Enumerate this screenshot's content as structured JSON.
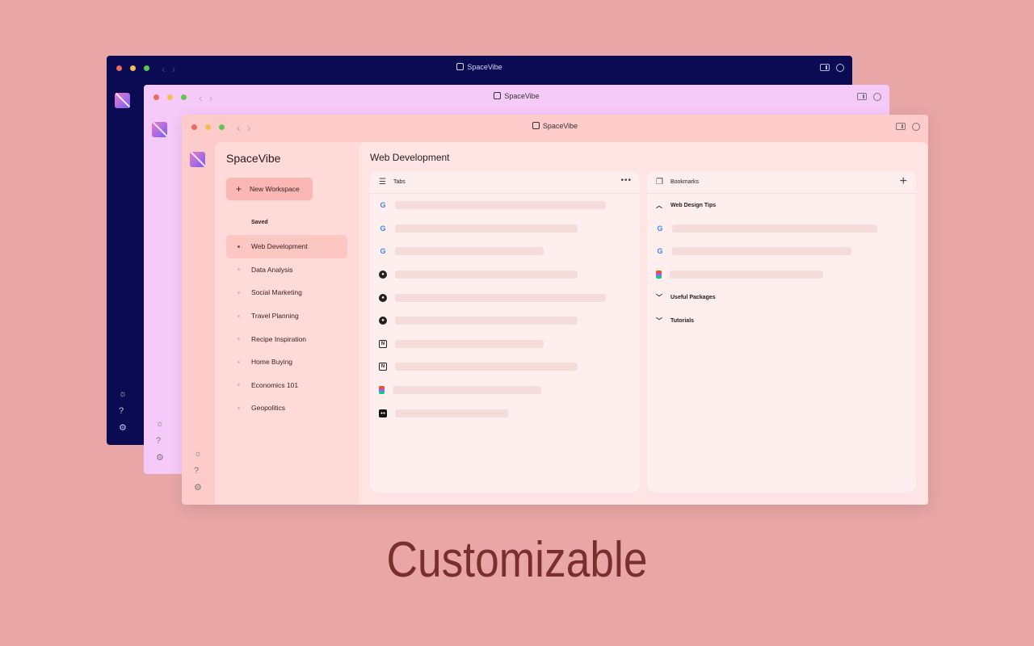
{
  "app": {
    "name": "SpaceVibe",
    "window_title": "SpaceVibe"
  },
  "window_colors": [
    "#0a0b52",
    "#f6caf8",
    "#fecbcb"
  ],
  "sidebar": {
    "new_workspace_label": "New Workspace",
    "saved_heading": "Saved",
    "workspaces": [
      {
        "label": "Web Development",
        "active": true
      },
      {
        "label": "Data Analysis"
      },
      {
        "label": "Social Marketing"
      },
      {
        "label": "Travel Planning"
      },
      {
        "label": "Recipe Inspiration"
      },
      {
        "label": "Home Buying"
      },
      {
        "label": "Economics 101"
      },
      {
        "label": "Geopolitics"
      }
    ]
  },
  "rail_icons": [
    "theme-sun-icon",
    "help-icon",
    "settings-gear-icon"
  ],
  "main": {
    "title": "Web Development",
    "tabs_panel": {
      "heading": "Tabs",
      "items": [
        {
          "icon": "google-icon",
          "fill": 0.82
        },
        {
          "icon": "google-icon",
          "fill": 0.71
        },
        {
          "icon": "google-icon",
          "fill": 0.58
        },
        {
          "icon": "github-icon",
          "fill": 0.71
        },
        {
          "icon": "github-icon",
          "fill": 0.82
        },
        {
          "icon": "github-icon",
          "fill": 0.71
        },
        {
          "icon": "notion-icon",
          "fill": 0.58
        },
        {
          "icon": "notion-icon",
          "fill": 0.71
        },
        {
          "icon": "figma-icon",
          "fill": 0.58
        },
        {
          "icon": "medium-icon",
          "fill": 0.44
        }
      ]
    },
    "bookmarks_panel": {
      "heading": "Bookmarks",
      "folders": [
        {
          "label": "Web Design Tips",
          "expanded": true,
          "items": [
            {
              "icon": "google-icon",
              "fill": 0.8
            },
            {
              "icon": "google-icon",
              "fill": 0.7
            },
            {
              "icon": "figma-icon",
              "fill": 0.6
            }
          ]
        },
        {
          "label": "Useful Packages",
          "expanded": false,
          "items": []
        },
        {
          "label": "Tutorials",
          "expanded": false,
          "items": []
        }
      ]
    }
  },
  "tagline": "Customizable"
}
